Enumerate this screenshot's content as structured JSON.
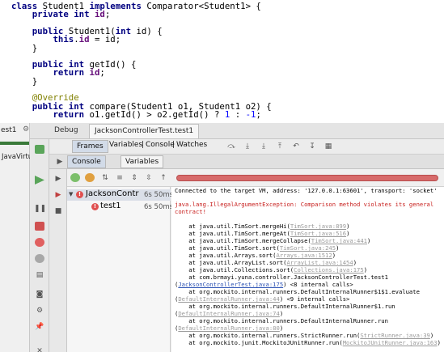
{
  "code": {
    "lines": [
      {
        "segments": [
          {
            "t": "class ",
            "c": "kw"
          },
          {
            "t": "Student1 "
          },
          {
            "t": "implements ",
            "c": "kw"
          },
          {
            "t": "Comparator<Student1> {"
          }
        ]
      },
      {
        "segments": [
          {
            "t": "    "
          },
          {
            "t": "private int ",
            "c": "kw"
          },
          {
            "t": "id",
            "c": "fld"
          },
          {
            "t": ";"
          }
        ]
      },
      {
        "segments": []
      },
      {
        "segments": [
          {
            "t": "    "
          },
          {
            "t": "public ",
            "c": "kw"
          },
          {
            "t": "Student1("
          },
          {
            "t": "int ",
            "c": "kw"
          },
          {
            "t": "id) {"
          }
        ]
      },
      {
        "segments": [
          {
            "t": "        "
          },
          {
            "t": "this",
            "c": "kw"
          },
          {
            "t": "."
          },
          {
            "t": "id",
            "c": "fld"
          },
          {
            "t": " = id;"
          }
        ]
      },
      {
        "segments": [
          {
            "t": "    }"
          }
        ]
      },
      {
        "segments": []
      },
      {
        "segments": [
          {
            "t": "    "
          },
          {
            "t": "public int ",
            "c": "kw"
          },
          {
            "t": "getId() {"
          }
        ]
      },
      {
        "segments": [
          {
            "t": "        "
          },
          {
            "t": "return ",
            "c": "kw"
          },
          {
            "t": "id",
            "c": "fld"
          },
          {
            "t": ";"
          }
        ]
      },
      {
        "segments": [
          {
            "t": "    }"
          }
        ]
      },
      {
        "segments": []
      },
      {
        "segments": [
          {
            "t": "    "
          },
          {
            "t": "@Override",
            "c": "ann"
          }
        ]
      },
      {
        "segments": [
          {
            "t": "    "
          },
          {
            "t": "public int ",
            "c": "kw"
          },
          {
            "t": "compare(Student1 o1, Student1 o2) {"
          }
        ]
      },
      {
        "segments": [
          {
            "t": "        "
          },
          {
            "t": "return ",
            "c": "kw"
          },
          {
            "t": "o1.getId() > o2.getId() ? "
          },
          {
            "t": "1",
            "c": "num"
          },
          {
            "t": " : "
          },
          {
            "t": "-1",
            "c": "num"
          },
          {
            "t": ";"
          }
        ]
      }
    ]
  },
  "debug": {
    "left_label": "est1",
    "left_item": "JavaVirtu",
    "title_label": "Debug",
    "run_tab": "JacksonControllerTest.test1",
    "tabs": [
      "Frames",
      "Variables",
      "Console",
      "Watches"
    ],
    "sub_tabs": {
      "console": "Console",
      "variables": "Variables"
    },
    "tree": {
      "root": {
        "name": "JacksonContr",
        "time": "6s 50ms"
      },
      "child": {
        "name": "test1",
        "time": "6s 50ms"
      }
    },
    "console_lines": [
      {
        "cls": "",
        "segments": [
          {
            "t": "Connected to the target VM, address: '127.0.0.1:63601', transport: 'socket'"
          }
        ]
      },
      {
        "cls": "",
        "segments": []
      },
      {
        "cls": "red",
        "segments": [
          {
            "t": "java.lang.IllegalArgumentException: Comparison method violates its general"
          }
        ]
      },
      {
        "cls": "red",
        "segments": [
          {
            "t": "contract!"
          }
        ]
      },
      {
        "cls": "",
        "segments": []
      },
      {
        "cls": "",
        "segments": [
          {
            "t": "    at java.util.TimSort.mergeHi("
          },
          {
            "t": "TimSort.java:899",
            "c": "glnk"
          },
          {
            "t": ")"
          }
        ]
      },
      {
        "cls": "",
        "segments": [
          {
            "t": "    at java.util.TimSort.mergeAt("
          },
          {
            "t": "TimSort.java:516",
            "c": "glnk"
          },
          {
            "t": ")"
          }
        ]
      },
      {
        "cls": "",
        "segments": [
          {
            "t": "    at java.util.TimSort.mergeCollapse("
          },
          {
            "t": "TimSort.java:441",
            "c": "glnk"
          },
          {
            "t": ")"
          }
        ]
      },
      {
        "cls": "",
        "segments": [
          {
            "t": "    at java.util.TimSort.sort("
          },
          {
            "t": "TimSort.java:245",
            "c": "glnk"
          },
          {
            "t": ")"
          }
        ]
      },
      {
        "cls": "",
        "segments": [
          {
            "t": "    at java.util.Arrays.sort("
          },
          {
            "t": "Arrays.java:1512",
            "c": "glnk"
          },
          {
            "t": ")"
          }
        ]
      },
      {
        "cls": "",
        "segments": [
          {
            "t": "    at java.util.ArrayList.sort("
          },
          {
            "t": "ArrayList.java:1454",
            "c": "glnk"
          },
          {
            "t": ")"
          }
        ]
      },
      {
        "cls": "",
        "segments": [
          {
            "t": "    at java.util.Collections.sort("
          },
          {
            "t": "Collections.java:175",
            "c": "glnk"
          },
          {
            "t": ")"
          }
        ]
      },
      {
        "cls": "",
        "segments": [
          {
            "t": "    at com.brmayi.yuna.controller.JacksonControllerTest.test1"
          }
        ]
      },
      {
        "cls": "",
        "segments": [
          {
            "t": "("
          },
          {
            "t": "JacksonControllerTest.java:175",
            "c": "lnk"
          },
          {
            "t": ") <8 internal calls>"
          }
        ]
      },
      {
        "cls": "",
        "segments": [
          {
            "t": "    at org.mockito.internal.runners.DefaultInternalRunner$1$1.evaluate"
          }
        ]
      },
      {
        "cls": "",
        "segments": [
          {
            "t": "("
          },
          {
            "t": "DefaultInternalRunner.java:44",
            "c": "glnk"
          },
          {
            "t": ") <9 internal calls>"
          }
        ]
      },
      {
        "cls": "",
        "segments": [
          {
            "t": "    at org.mockito.internal.runners.DefaultInternalRunner$1.run"
          }
        ]
      },
      {
        "cls": "",
        "segments": [
          {
            "t": "("
          },
          {
            "t": "DefaultInternalRunner.java:74",
            "c": "glnk"
          },
          {
            "t": ")"
          }
        ]
      },
      {
        "cls": "",
        "segments": [
          {
            "t": "    at org.mockito.internal.runners.DefaultInternalRunner.run"
          }
        ]
      },
      {
        "cls": "",
        "segments": [
          {
            "t": "("
          },
          {
            "t": "DefaultInternalRunner.java:80",
            "c": "glnk"
          },
          {
            "t": ")"
          }
        ]
      },
      {
        "cls": "",
        "segments": [
          {
            "t": "    at org.mockito.internal.runners.StrictRunner.run("
          },
          {
            "t": "StrictRunner.java:39",
            "c": "glnk"
          },
          {
            "t": ")"
          }
        ]
      },
      {
        "cls": "",
        "segments": [
          {
            "t": "    at org.mockito.junit.MockitoJUnitRunner.run("
          },
          {
            "t": "MockitoJUnitRunner.java:163",
            "c": "glnk"
          },
          {
            "t": ")"
          }
        ]
      }
    ]
  },
  "colors": {
    "keyword": "#000080",
    "field": "#660e7a",
    "annotation": "#808000",
    "error_red": "#c8201e",
    "progress_fail": "#d76b6b",
    "link_blue": "#2f55b5"
  },
  "icons": [
    "rerun-icon",
    "step-over-icon",
    "step-into-icon",
    "step-out-icon",
    "resume-icon",
    "pause-icon",
    "stop-icon",
    "breakpoints-icon",
    "mute-icon",
    "settings-icon",
    "pin-icon",
    "console-icon",
    "variables-icon",
    "test-pass-icon",
    "test-fail-icon"
  ]
}
